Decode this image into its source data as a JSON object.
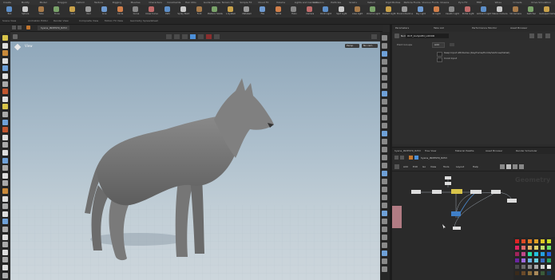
{
  "shelf": {
    "tabs": [
      "Create",
      "Modify",
      "Model",
      "Polygon",
      "Deform",
      "Texture",
      "Rigging",
      "Muscles",
      "Characters",
      "Constraints",
      "Hair Utils",
      "Guide Process",
      "Terrain FX",
      "Simple FX",
      "Cloud FX",
      "Volume",
      "Lights and Cameras",
      "Collisions",
      "Particles",
      "Grains",
      "Vellum",
      "Rigid Bodies",
      "Particle Fluids",
      "Viscous Fluids",
      "Oceans",
      "Pyro FX",
      "FEM",
      "Wires",
      "Crowds",
      "Drive Simulation"
    ],
    "tools": [
      "Box",
      "Sphere",
      "Tube",
      "Torus",
      "Grid",
      "Null",
      "Line",
      "Circle",
      "Curve",
      "Draw Curve",
      "Path",
      "Spray Paint",
      "Font",
      "Platonic Solids",
      "L-System",
      "Metaball",
      "File",
      "Spiral",
      "Helix",
      "Camera",
      "Point Light",
      "Spot Light",
      "Area Light",
      "Volume Light",
      "Distant Light",
      "Environment Light",
      "Sky Light",
      "GI Light",
      "Caustic Light",
      "Portal Light",
      "Ambient Light",
      "Stereo Camera",
      "VR Camera",
      "Switcher",
      "Gamepad Camera"
    ]
  },
  "desktop_bar": [
    "Scene View",
    "Animation Editor",
    "Render View",
    "Composite View",
    "Motion FX View",
    "Geometry Spreadsheet"
  ],
  "viewport": {
    "tab_path": "hyena_INVESTR_8253",
    "label": "View",
    "persp_button": "Persp",
    "cam_button": "No cam"
  },
  "parameters": {
    "tabs": [
      "Parameters",
      "Take List",
      "Performance Monitor",
      "Asset Browser"
    ],
    "node_type": "Null",
    "node_name": "OUT_bodyGEO_LODOR",
    "row_label": "Point Groups",
    "row_value": "Add",
    "checkbox1": "Keep Input Attributes (Keyframe/Points/Vertices/Detail)",
    "checkbox2": "Cook Input"
  },
  "network": {
    "tabs": [
      "hyena_INVESTR_8253",
      "Tree View",
      "Material Palette",
      "Asset Browser",
      "Render Scheduler"
    ],
    "path": "hyena_INVESTR_8253",
    "menu": [
      "Add",
      "Edit",
      "Go",
      "View",
      "Tools",
      "Layout",
      "Help"
    ],
    "watermark": "Geometry"
  },
  "colors": {
    "accent_blue": "#4c8fd8",
    "node_flag_yellow": "#d8c44a",
    "node_flag_blue": "#3f7fc7"
  }
}
